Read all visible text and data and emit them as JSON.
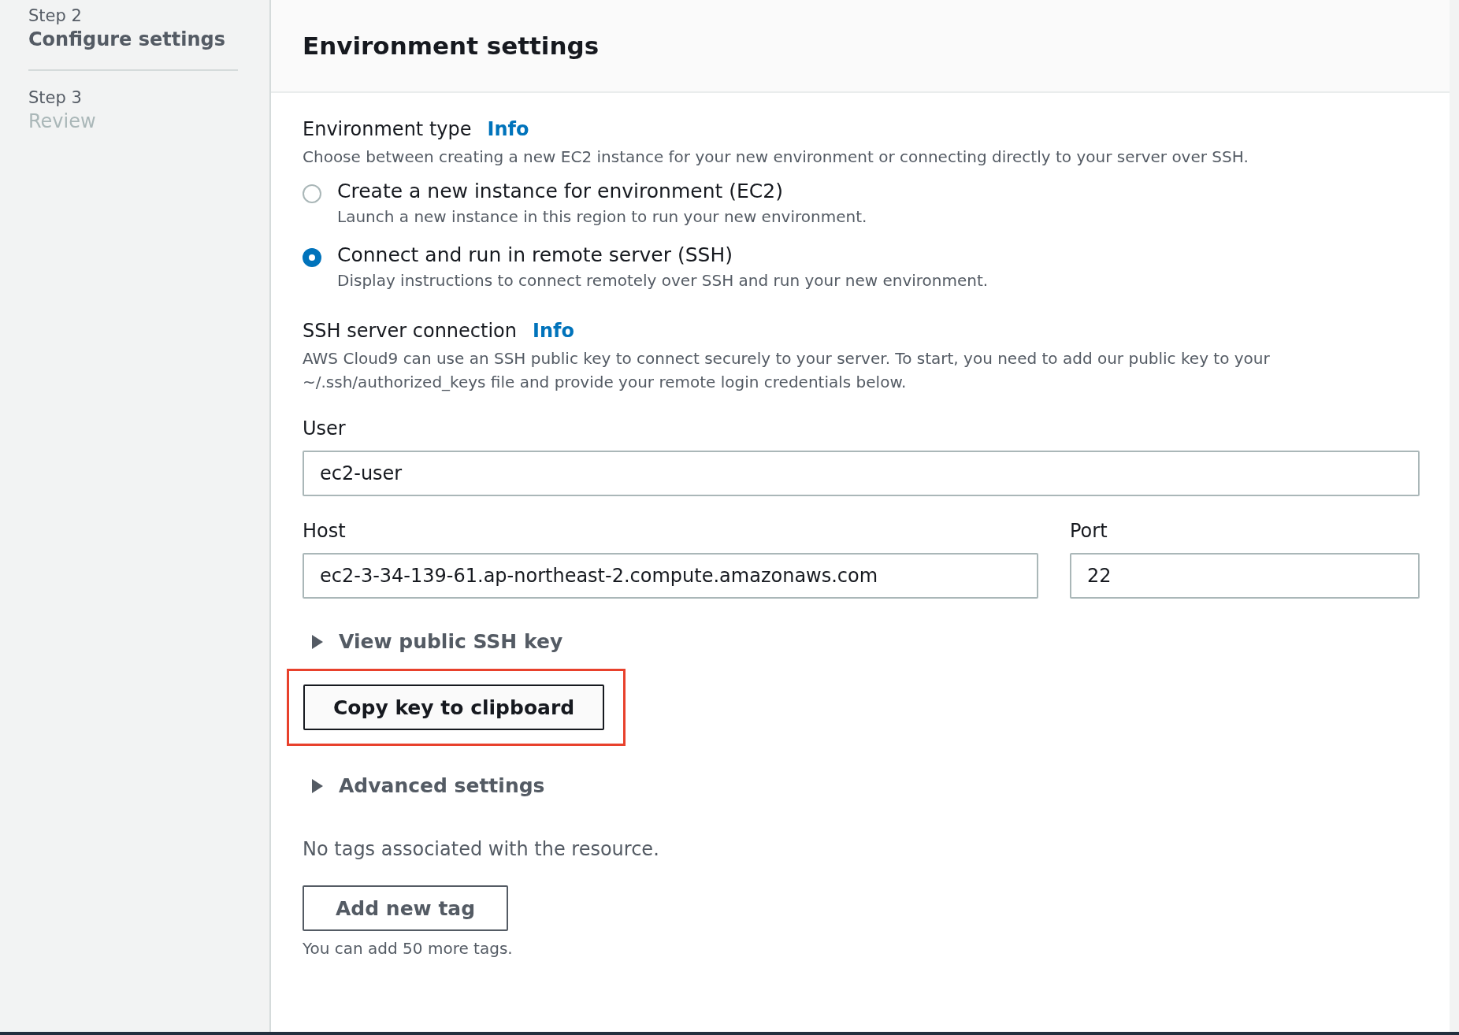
{
  "steps": [
    {
      "label": "Step 2",
      "title": "Configure settings",
      "selected": true
    },
    {
      "label": "Step 3",
      "title": "Review",
      "selected": false
    }
  ],
  "panel": {
    "title": "Environment settings",
    "environment_type": {
      "label": "Environment type",
      "info": "Info",
      "description": "Choose between creating a new EC2 instance for your new environment or connecting directly to your server over SSH.",
      "options": [
        {
          "label": "Create a new instance for environment (EC2)",
          "description": "Launch a new instance in this region to run your new environment.",
          "selected": false
        },
        {
          "label": "Connect and run in remote server (SSH)",
          "description": "Display instructions to connect remotely over SSH and run your new environment.",
          "selected": true
        }
      ]
    },
    "ssh_connection": {
      "label": "SSH server connection",
      "info": "Info",
      "description": "AWS Cloud9 can use an SSH public key to connect securely to your server. To start, you need to add our public key to your ~/.ssh/authorized_keys file and provide your remote login credentials below."
    },
    "user": {
      "label": "User",
      "value": "ec2-user"
    },
    "host": {
      "label": "Host",
      "value": "ec2-3-34-139-61.ap-northeast-2.compute.amazonaws.com"
    },
    "port": {
      "label": "Port",
      "value": "22"
    },
    "view_key": {
      "label": "View public SSH key",
      "expanded": false
    },
    "copy_button": {
      "label": "Copy key to clipboard",
      "highlighted": true
    },
    "advanced": {
      "label": "Advanced settings",
      "expanded": false
    },
    "tags_message": "No tags associated with the resource.",
    "add_tag_button": "Add new tag",
    "tags_hint": "You can add 50 more tags."
  }
}
